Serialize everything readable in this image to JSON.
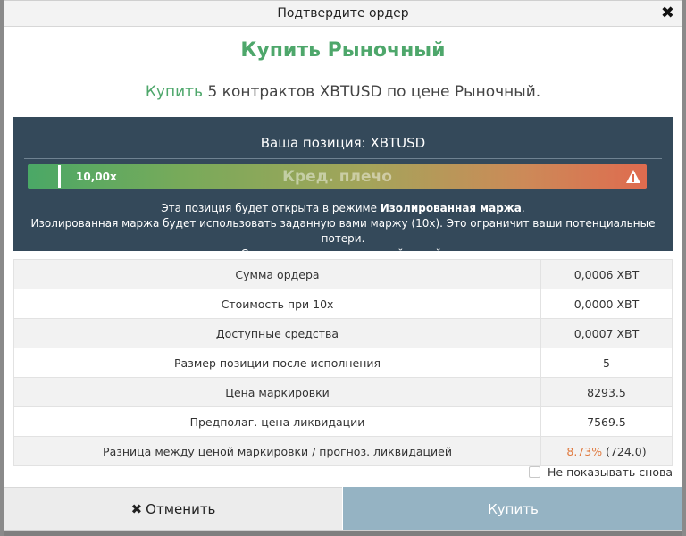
{
  "dialog": {
    "title": "Подтвердите ордер",
    "close_glyph": "✖"
  },
  "header": {
    "heading": "Купить Рыночный",
    "summary_buy": "Купить",
    "summary_rest": " 5 контрактов XBTUSD по цене Рыночный."
  },
  "position": {
    "title": "Ваша позиция: XBTUSD",
    "leverage_value": "10,00x",
    "leverage_label": "Кред. плечо",
    "info_line1_prefix": "Эта позиция будет открыта в режиме ",
    "info_line1_bold": "Изолированная маржа",
    "info_line1_suffix": ".",
    "info_line2": "Изолированная маржа будет использовать заданную вами маржу (10x). Это ограничит ваши потенциальные потери.",
    "info_line3": "Следите за ликвидационной ценой."
  },
  "details": [
    {
      "label": "Сумма ордера",
      "value": "0,0006 XBT"
    },
    {
      "label": "Стоимость при 10x",
      "value": "0,0000 XBT"
    },
    {
      "label": "Доступные средства",
      "value": "0,0007 XBT"
    },
    {
      "label": "Размер позиции после исполнения",
      "value": "5"
    },
    {
      "label": "Цена маркировки",
      "value": "8293.5"
    },
    {
      "label": "Предполаг. цена ликвидации",
      "value": "7569.5"
    },
    {
      "label": "Разница между ценой маркировки / прогноз. ликвидацией",
      "value_pct": "8.73%",
      "value_rest": " (724.0)"
    }
  ],
  "options": {
    "dont_show_again": "Не показывать снова"
  },
  "footer": {
    "cancel_glyph": "✖",
    "cancel_label": "Отменить",
    "buy_label": "Купить"
  },
  "colors": {
    "accent_green": "#4ea76b",
    "panel_bg": "#34495a",
    "buy_button": "#95b3c3",
    "liq_pct": "#e07a3f"
  }
}
